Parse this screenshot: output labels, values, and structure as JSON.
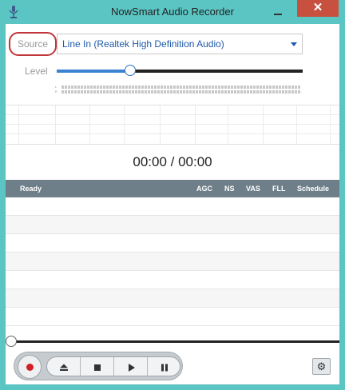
{
  "window": {
    "title": "NowSmart Audio Recorder",
    "close_glyph": "✕",
    "accent_color": "#5bc5c3",
    "close_color": "#c7503f"
  },
  "source": {
    "label": "Source",
    "selected": "Line In (Realtek High Definition Audio)"
  },
  "level": {
    "label": "Level",
    "value_fraction": 0.3,
    "channels": [
      "L",
      "R"
    ]
  },
  "time": {
    "display": "00:00 / 00:00"
  },
  "list": {
    "columns": [
      "Ready",
      "AGC",
      "NS",
      "VAS",
      "FLL",
      "Schedule"
    ],
    "empty_rows": 7
  },
  "progress": {
    "value_fraction": 0.0
  },
  "icons": {
    "app": "microphone-icon",
    "settings": "gear-icon",
    "settings_glyph": "⚙"
  },
  "colors": {
    "record": "#d21f26",
    "source_highlight": "#c0363a",
    "header_bg": "#6f7f89",
    "link_text": "#1e5aa8"
  }
}
